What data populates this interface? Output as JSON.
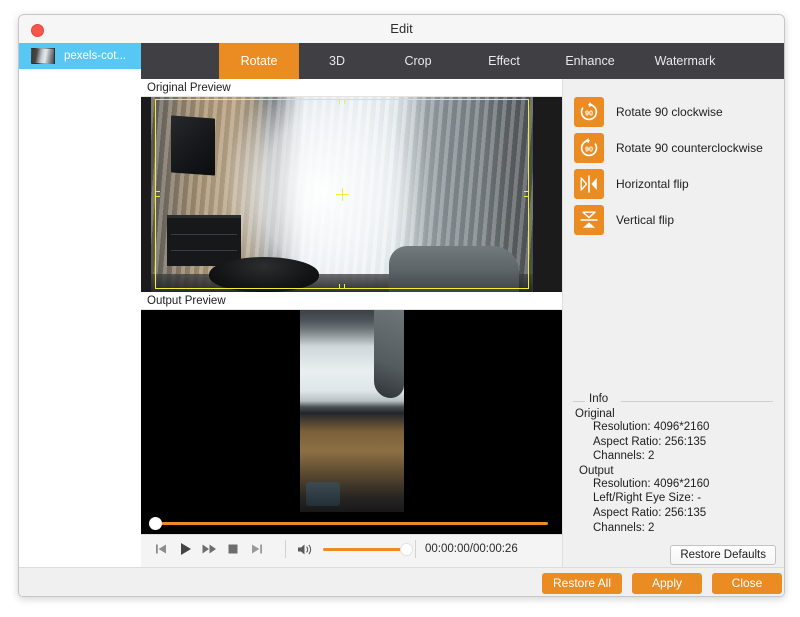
{
  "window": {
    "title": "Edit",
    "close_button": "close-window"
  },
  "sidebar": {
    "files": [
      {
        "name": "pexels-cot...",
        "thumb": "video-thumbnail",
        "selected": true
      }
    ]
  },
  "tabs": [
    {
      "label": "Rotate",
      "active": true
    },
    {
      "label": "3D",
      "active": false
    },
    {
      "label": "Crop",
      "active": false
    },
    {
      "label": "Effect",
      "active": false
    },
    {
      "label": "Enhance",
      "active": false
    },
    {
      "label": "Watermark",
      "active": false
    }
  ],
  "preview": {
    "original_caption": "Original Preview",
    "output_caption": "Output Preview"
  },
  "rotate_actions": [
    {
      "label": "Rotate 90 clockwise",
      "icon": "rotate-clockwise-90-icon",
      "badge": "90"
    },
    {
      "label": "Rotate 90 counterclockwise",
      "icon": "rotate-counterclockwise-90-icon",
      "badge": "90"
    },
    {
      "label": "Horizontal flip",
      "icon": "horizontal-flip-icon",
      "badge": ""
    },
    {
      "label": "Vertical flip",
      "icon": "vertical-flip-icon",
      "badge": ""
    }
  ],
  "transport": {
    "buttons": [
      {
        "name": "previous-frame-button",
        "icon": "skip-back-icon"
      },
      {
        "name": "play-button",
        "icon": "play-icon"
      },
      {
        "name": "fast-forward-button",
        "icon": "fast-forward-icon"
      },
      {
        "name": "stop-button",
        "icon": "stop-icon"
      },
      {
        "name": "next-frame-button",
        "icon": "skip-forward-icon"
      }
    ],
    "volume_icon": "speaker-icon",
    "volume_level": 100,
    "timecode": "00:00:00/00:00:26",
    "progress_percent": 0
  },
  "info": {
    "legend": "Info",
    "original_title": "Original",
    "original_lines": [
      "Resolution: 4096*2160",
      "Aspect Ratio: 256:135",
      "Channels: 2"
    ],
    "output_title": "Output",
    "output_lines": [
      "Resolution: 4096*2160",
      "Left/Right Eye Size: -",
      "Aspect Ratio: 256:135",
      "Channels: 2"
    ],
    "restore_defaults_label": "Restore Defaults"
  },
  "footer": {
    "restore_all_label": "Restore All",
    "apply_label": "Apply",
    "close_label": "Close"
  },
  "colors": {
    "accent": "#ea8c22",
    "tabbar": "#403f44",
    "selection": "#57c7f4",
    "crop_outline": "#f3ef2d"
  }
}
